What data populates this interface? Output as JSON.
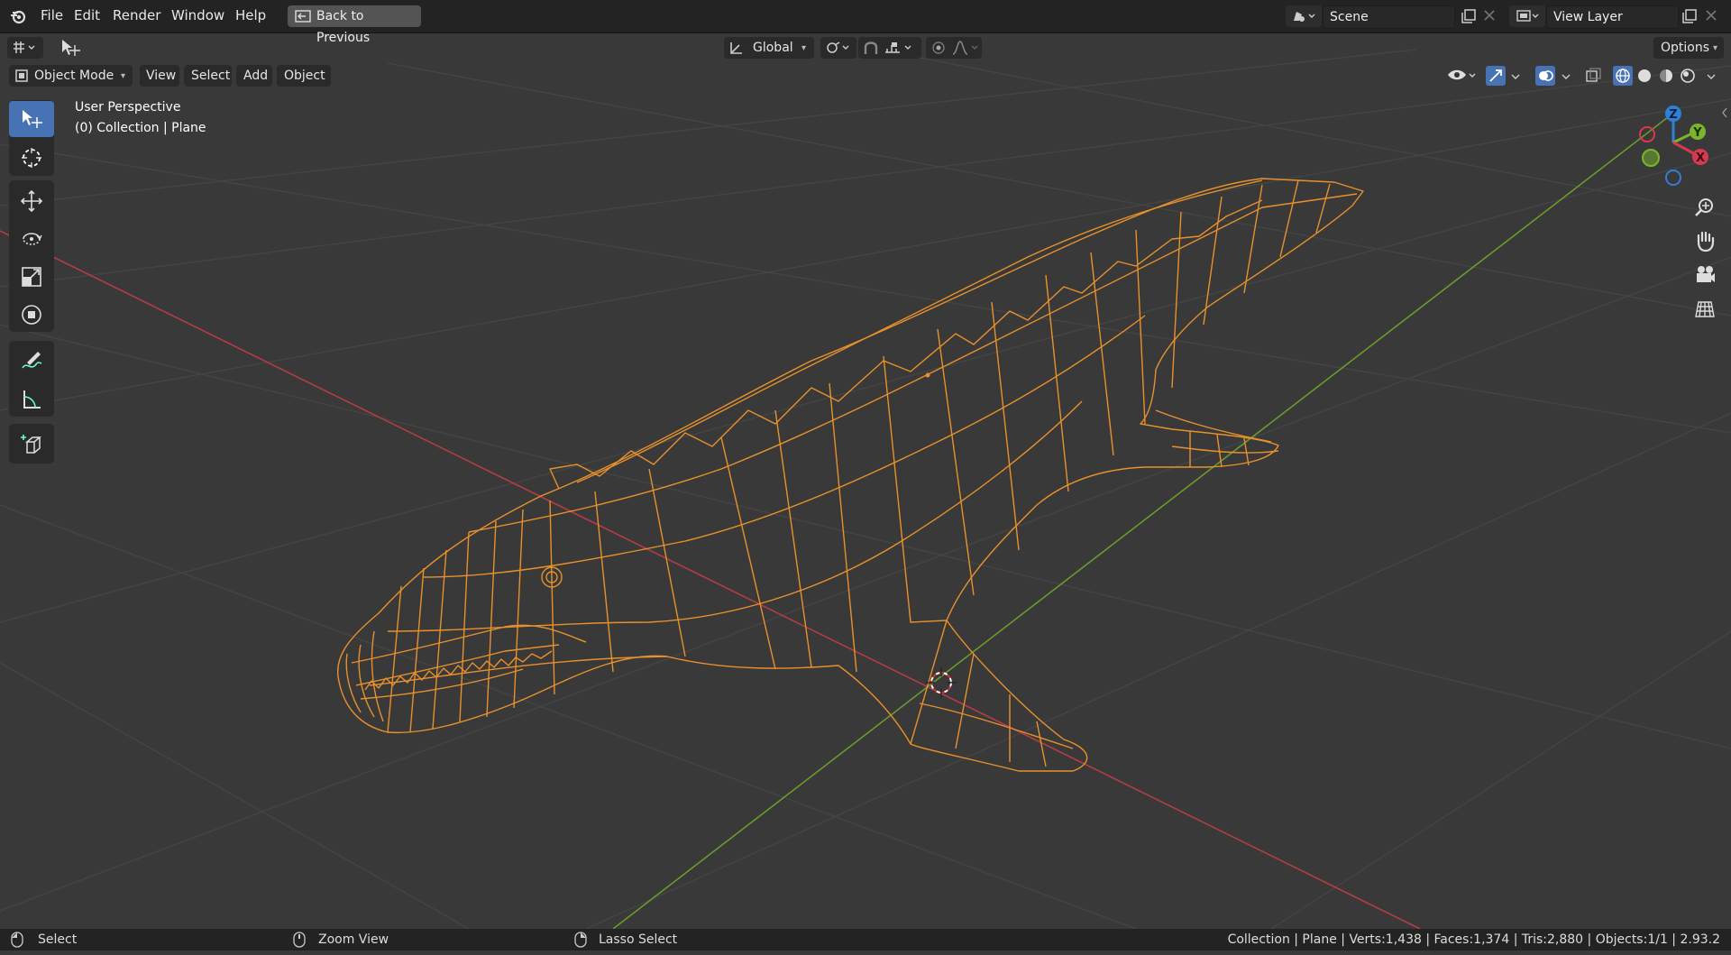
{
  "menu": {
    "app_logo": "blender-logo-icon",
    "items": [
      "File",
      "Edit",
      "Render",
      "Window",
      "Help"
    ],
    "back_button": "Back to Previous"
  },
  "scene": {
    "label": "Scene"
  },
  "view_layer": {
    "label": "View Layer"
  },
  "tool_header": {
    "transform_orientation": "Global",
    "options_label": "Options"
  },
  "viewport_header": {
    "mode": "Object Mode",
    "menus": [
      "View",
      "Select",
      "Add",
      "Object"
    ]
  },
  "viewport": {
    "perspective": "User Perspective",
    "context": "(0) Collection | Plane",
    "shading": "wireframe",
    "colors": {
      "background": "#393939",
      "wire_selected": "#e8912c",
      "axis_x": "#b43c46",
      "axis_y": "#6a9a2e",
      "active_tool": "#4772b3"
    }
  },
  "gizmo": {
    "z": "Z",
    "y": "Y",
    "x": "X"
  },
  "toolbar": {
    "tools": [
      "select-box-icon",
      "cursor-icon",
      "move-icon",
      "rotate-icon",
      "scale-icon",
      "transform-icon",
      "annotate-icon",
      "measure-icon",
      "add-cube-icon"
    ],
    "active": "select-box-icon"
  },
  "nav_buttons": [
    "zoom-icon",
    "pan-hand-icon",
    "camera-view-icon",
    "ortho-grid-icon"
  ],
  "status": {
    "left": "Select",
    "middle": "Zoom View",
    "right": "Lasso Select",
    "stats": "Collection | Plane | Verts:1,438 | Faces:1,374 | Tris:2,880 | Objects:1/1 | 2.93.2"
  }
}
